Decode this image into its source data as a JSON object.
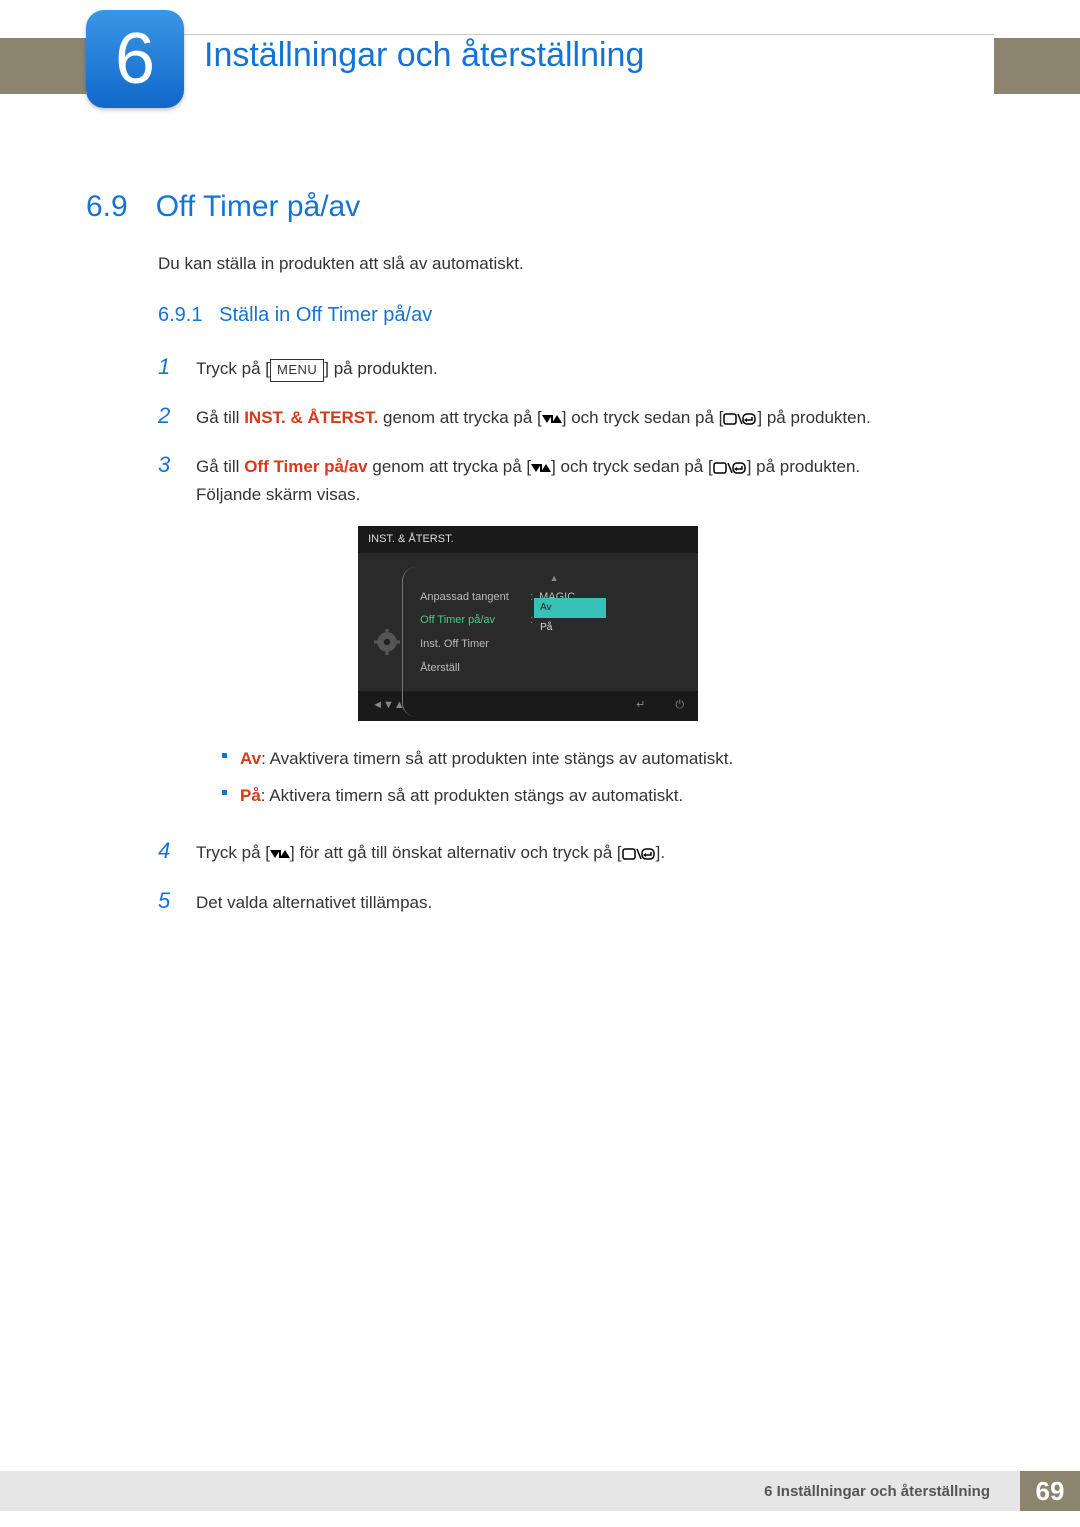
{
  "chapter": {
    "number": "6",
    "title": "Inställningar och återställning"
  },
  "section": {
    "number": "6.9",
    "title": "Off Timer på/av",
    "intro": "Du kan ställa in produkten att slå av automatiskt."
  },
  "subsection": {
    "number": "6.9.1",
    "title": "Ställa in Off Timer på/av"
  },
  "steps": {
    "1": {
      "a": "Tryck på [",
      "menu": "MENU",
      "b": "] på produkten."
    },
    "2": {
      "a": "Gå till ",
      "bold": "INST. & ÅTERST.",
      "b": " genom att trycka på [",
      "c": "] och tryck sedan på [",
      "d": "] på produkten."
    },
    "3": {
      "a": "Gå till ",
      "bold": "Off Timer på/av",
      "b": " genom att trycka på [",
      "c": "] och tryck sedan på [",
      "d": "] på produkten.",
      "e": "Följande skärm visas."
    },
    "4": {
      "a": "Tryck på [",
      "b": "] för att gå till önskat alternativ och tryck på [",
      "c": "]."
    },
    "5": {
      "a": "Det valda alternativet tillämpas."
    }
  },
  "bullets": {
    "av": {
      "label": "Av",
      "text": ": Avaktivera timern så att produkten inte stängs av automatiskt."
    },
    "pa": {
      "label": "På",
      "text": ": Aktivera timern så att produkten stängs av automatiskt."
    }
  },
  "osd": {
    "title": "INST. & ÅTERST.",
    "items": {
      "0": {
        "label": "Anpassad tangent",
        "value": "MAGIC"
      },
      "1": {
        "label": "Off Timer på/av"
      },
      "2": {
        "label": "Inst. Off Timer"
      },
      "3": {
        "label": "Återställ"
      }
    },
    "dropdown": {
      "0": "Av",
      "1": "På"
    },
    "nav": {
      "back": "◄",
      "down": "▼",
      "up": "▲",
      "enter": "↵",
      "power": "⏻"
    }
  },
  "footer": {
    "label": "6 Inställningar och återställning",
    "page": "69"
  }
}
